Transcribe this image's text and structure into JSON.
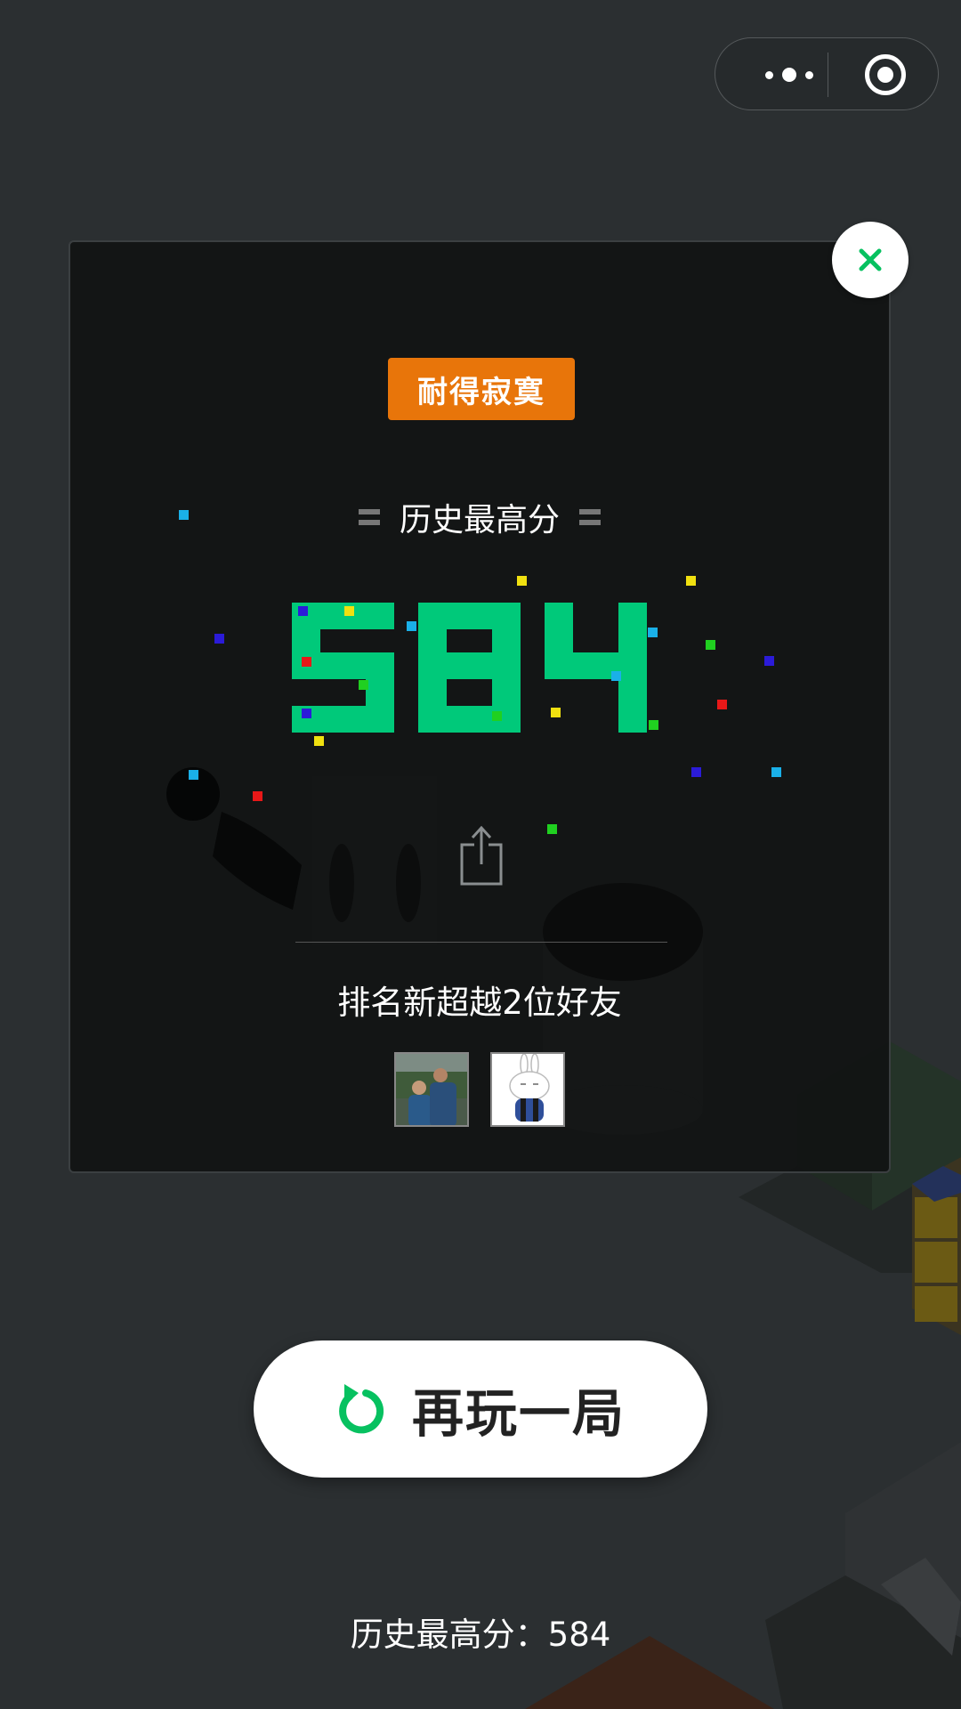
{
  "menu": {
    "more_icon": "more-dots-icon",
    "exit_icon": "target-circle-icon"
  },
  "modal": {
    "badge": "耐得寂寞",
    "best_title": "历史最高分",
    "best_score": "584",
    "share_icon": "share-icon",
    "rank_text": "排名新超越2位好友",
    "friends": [
      {
        "name": "friend-1"
      },
      {
        "name": "friend-2"
      }
    ],
    "close_icon": "close-icon"
  },
  "replay": {
    "label": "再玩一局",
    "icon": "replay-icon"
  },
  "footer": {
    "text": "历史最高分：584"
  },
  "colors": {
    "accent": "#07c160",
    "score": "#00c97a",
    "badge": "#e8750a",
    "background": "#2b2f31"
  }
}
